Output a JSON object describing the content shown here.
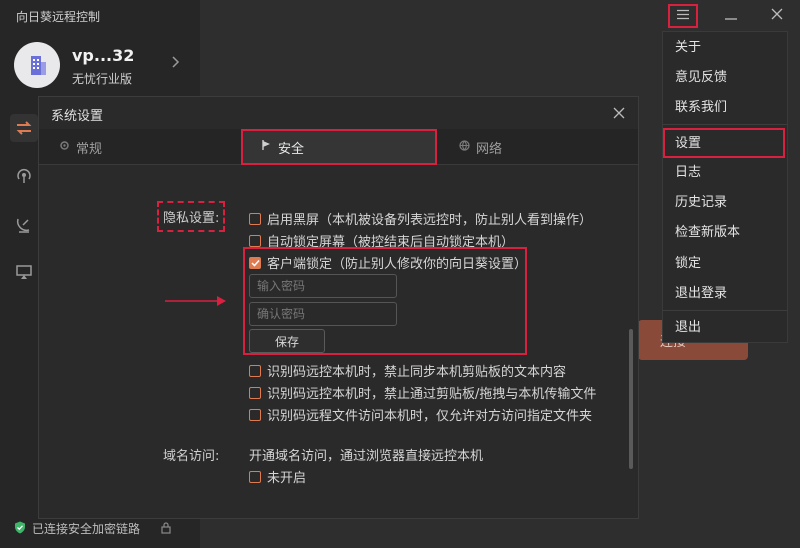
{
  "app": {
    "title": "向日葵远程控制"
  },
  "account": {
    "name": "vp...32",
    "plan": "无忧行业版"
  },
  "status": {
    "text": "已连接安全加密链路"
  },
  "background": {
    "button_label": "连接"
  },
  "menu": {
    "items": [
      "关于",
      "意见反馈",
      "联系我们",
      "设置",
      "日志",
      "历史记录",
      "检查新版本",
      "锁定",
      "退出登录",
      "退出"
    ]
  },
  "dialog": {
    "title": "系统设置",
    "tabs": [
      "常规",
      "安全",
      "网络"
    ],
    "privacy": {
      "label": "隐私设置:",
      "options": [
        "启用黑屏（本机被设备列表远控时，防止别人看到操作）",
        "自动锁定屏幕（被控结束后自动锁定本机）",
        "客户端锁定（防止别人修改你的向日葵设置）"
      ],
      "password_placeholder": "输入密码",
      "confirm_placeholder": "确认密码",
      "save_label": "保存",
      "more_options": [
        "识别码远控本机时，禁止同步本机剪贴板的文本内容",
        "识别码远控本机时，禁止通过剪贴板/拖拽与本机传输文件",
        "识别码远程文件访问本机时，仅允许对方访问指定文件夹"
      ]
    },
    "domain": {
      "label": "域名访问:",
      "description": "开通域名访问，通过浏览器直接远控本机",
      "status": "未开启"
    }
  },
  "colors": {
    "accent": "#e07a50",
    "highlight": "#d8203f"
  }
}
